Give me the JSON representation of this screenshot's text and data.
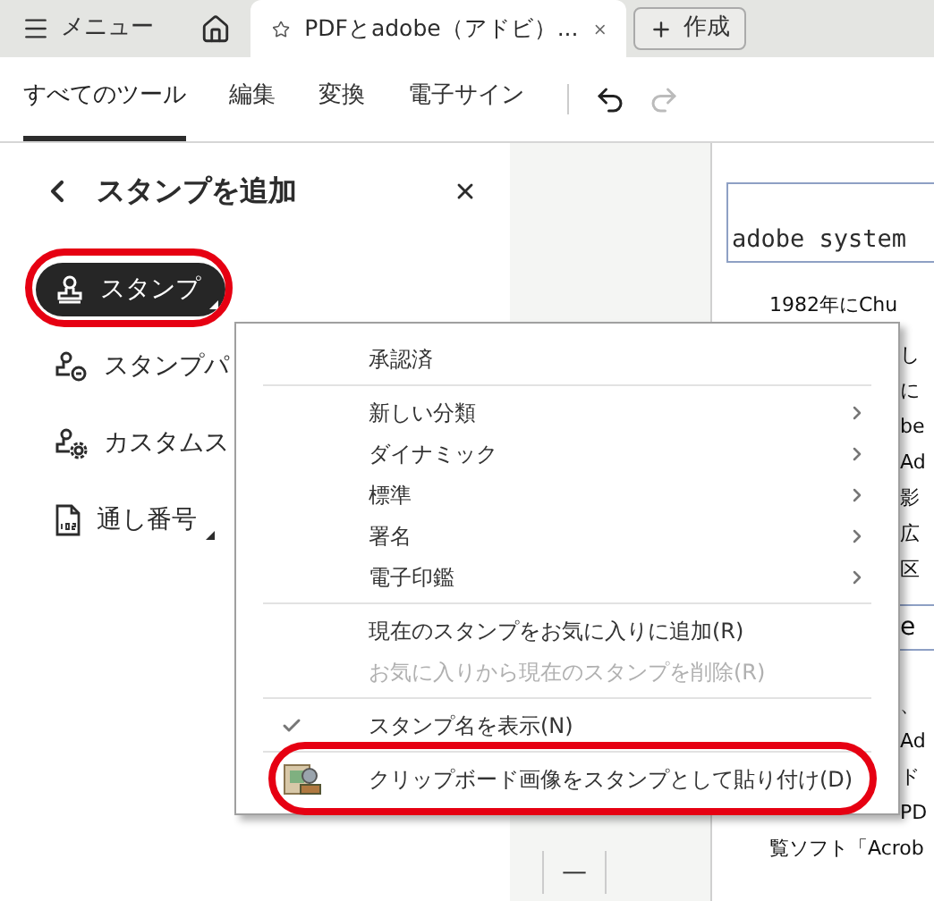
{
  "tab_bar": {
    "menu_button": {
      "label": "メニュー"
    },
    "tabs": [
      {
        "title": "PDFとadobe（アドビ）...",
        "selected": true
      }
    ],
    "create_button": {
      "label": "作成"
    }
  },
  "toolbar": {
    "items": [
      {
        "label": "すべてのツール",
        "selected": true
      },
      {
        "label": "編集",
        "selected": false
      },
      {
        "label": "変換",
        "selected": false
      },
      {
        "label": "電子サイン",
        "selected": false
      }
    ],
    "undo": {
      "disabled": false
    },
    "redo": {
      "disabled": true
    }
  },
  "panel": {
    "title": "スタンプを追加",
    "items": [
      {
        "kind": "stamp",
        "label": "スタンプ",
        "selected": true,
        "submenu": true,
        "highlighted": true
      },
      {
        "kind": "palette",
        "label": "スタンプパ",
        "selected": false,
        "highlighted": false
      },
      {
        "kind": "custom",
        "label": "カスタムス",
        "selected": false,
        "highlighted": false
      },
      {
        "kind": "numbering",
        "label": "通し番号",
        "selected": false,
        "submenu": true,
        "highlighted": false
      }
    ]
  },
  "context_menu": {
    "items": [
      {
        "kind": "item",
        "label": "承認済",
        "submenu": false,
        "disabled": false,
        "checked": false,
        "highlighted": false
      },
      {
        "kind": "separator"
      },
      {
        "kind": "item",
        "label": "新しい分類",
        "submenu": true,
        "disabled": false,
        "checked": false,
        "highlighted": false
      },
      {
        "kind": "item",
        "label": "ダイナミック",
        "submenu": true,
        "disabled": false,
        "checked": false,
        "highlighted": false
      },
      {
        "kind": "item",
        "label": "標準",
        "submenu": true,
        "disabled": false,
        "checked": false,
        "highlighted": false
      },
      {
        "kind": "item",
        "label": "署名",
        "submenu": true,
        "disabled": false,
        "checked": false,
        "highlighted": false
      },
      {
        "kind": "item",
        "label": "電子印鑑",
        "submenu": true,
        "disabled": false,
        "checked": false,
        "highlighted": false
      },
      {
        "kind": "separator"
      },
      {
        "kind": "item",
        "label": "現在のスタンプをお気に入りに追加(R)",
        "submenu": false,
        "disabled": false,
        "checked": false,
        "highlighted": false
      },
      {
        "kind": "item",
        "label": "お気に入りから現在のスタンプを削除(R)",
        "submenu": false,
        "disabled": true,
        "checked": false,
        "highlighted": false
      },
      {
        "kind": "separator"
      },
      {
        "kind": "item",
        "label": "スタンプ名を表示(N)",
        "submenu": false,
        "disabled": false,
        "checked": true,
        "highlighted": false
      },
      {
        "kind": "separator"
      },
      {
        "kind": "icon_item",
        "label": "クリップボード画像をスタンプとして貼り付け(D)",
        "submenu": false,
        "disabled": false,
        "checked": false,
        "highlighted": true
      }
    ]
  },
  "document": {
    "title_field": {
      "value": "adobe system"
    },
    "lines": [
      {
        "kind": "full",
        "text": "1982年にChu"
      },
      {
        "kind": "clipped",
        "text": "し"
      },
      {
        "kind": "clipped",
        "text": "に"
      },
      {
        "kind": "clipped",
        "text": "be"
      },
      {
        "kind": "clipped",
        "text": "Ad"
      },
      {
        "kind": "clipped",
        "text": "影"
      },
      {
        "kind": "clipped",
        "text": "広"
      },
      {
        "kind": "clipped",
        "text": "区"
      },
      {
        "kind": "heading",
        "text": "e"
      },
      {
        "kind": "clipped",
        "text": "、"
      },
      {
        "kind": "clipped",
        "text": "Ad"
      },
      {
        "kind": "clipped",
        "text": "ド"
      },
      {
        "kind": "clipped",
        "text": "PD"
      },
      {
        "kind": "full",
        "text": "覧ソフト「Acrob"
      }
    ]
  },
  "zoom_out_button": {
    "label": "—"
  }
}
